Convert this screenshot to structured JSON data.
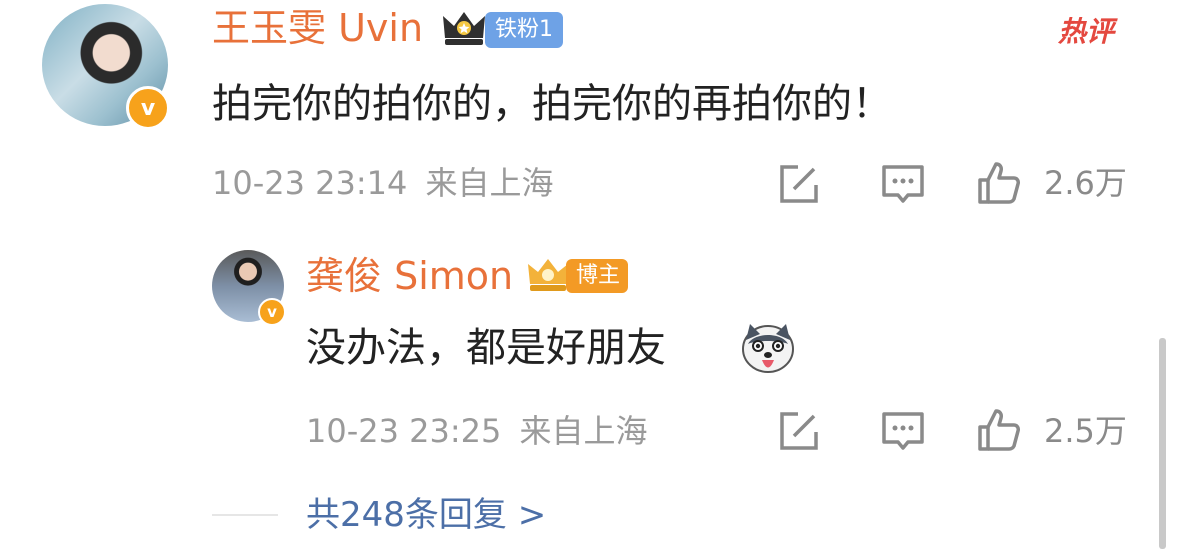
{
  "comment": {
    "username": "王玉雯 Uvin",
    "fan_badge": "铁粉1",
    "hot_label": "热评",
    "text": "拍完你的拍你的，拍完你的再拍你的！",
    "timestamp": "10-23 23:14",
    "location": "来自上海",
    "likes": "2.6万",
    "verified_mark": "v"
  },
  "reply": {
    "username": "龚俊 Simon",
    "role_badge": "博主",
    "text": "没办法，都是好朋友",
    "emoji": "husky-emoji",
    "timestamp": "10-23 23:25",
    "location": "来自上海",
    "likes": "2.5万",
    "verified_mark": "v"
  },
  "more_replies": "共248条回复 >",
  "colors": {
    "username": "#e8713a",
    "fan_badge": "#6ea2e6",
    "blogger_badge": "#f39a25",
    "hot": "#e4483f",
    "link": "#4c6fa7",
    "meta": "#9a9a9a"
  }
}
